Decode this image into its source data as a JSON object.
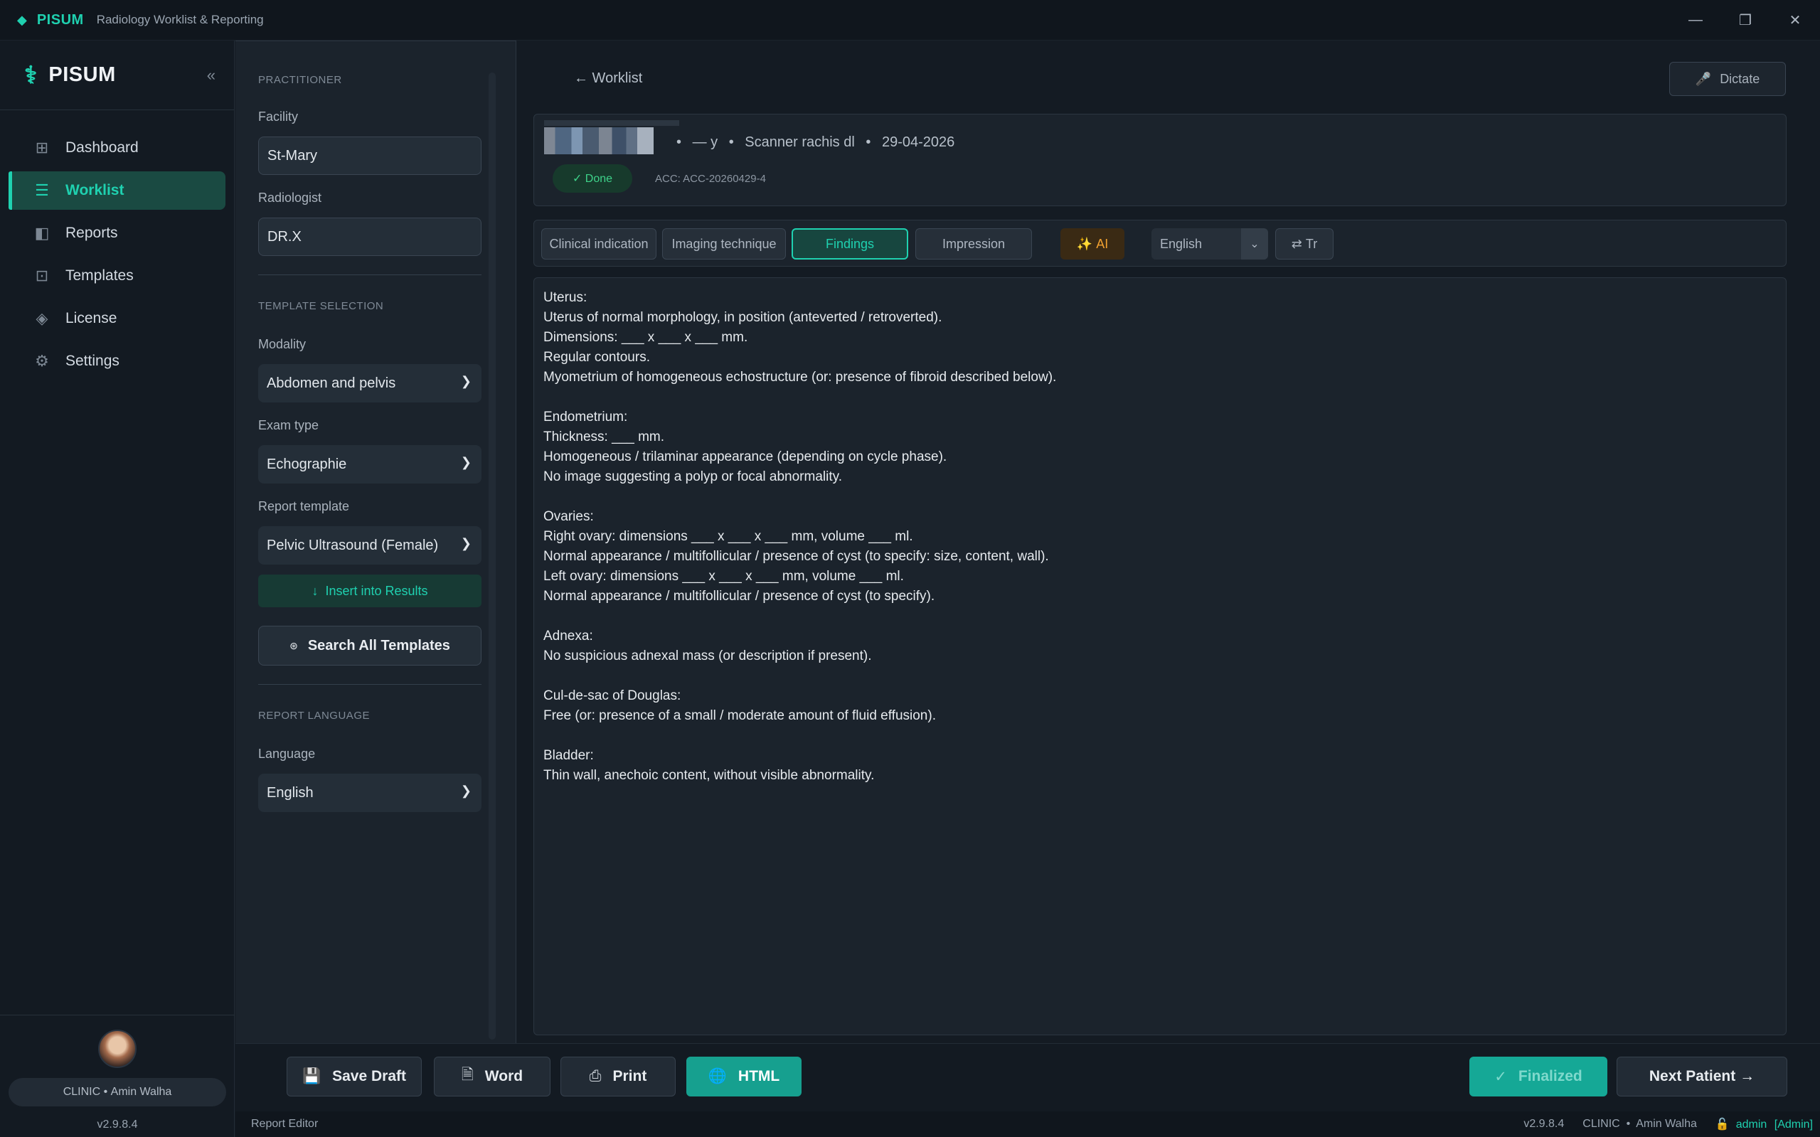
{
  "titlebar": {
    "brand": "PISUM",
    "subtitle": "Radiology Worklist & Reporting"
  },
  "sidebar": {
    "brand": "PISUM",
    "items": [
      {
        "label": "Dashboard",
        "icon": "grid-icon"
      },
      {
        "label": "Worklist",
        "icon": "list-icon",
        "active": true
      },
      {
        "label": "Reports",
        "icon": "report-icon"
      },
      {
        "label": "Templates",
        "icon": "template-icon"
      },
      {
        "label": "License",
        "icon": "license-icon"
      },
      {
        "label": "Settings",
        "icon": "gear-icon"
      }
    ],
    "user": {
      "clinic": "CLINIC",
      "name": "Amin Walha"
    },
    "version": "v2.9.8.4"
  },
  "config": {
    "practitioner_section": "PRACTITIONER",
    "facility_label": "Facility",
    "facility_value": "St-Mary",
    "radiologist_label": "Radiologist",
    "radiologist_value": "DR.X",
    "template_section": "TEMPLATE SELECTION",
    "modality_label": "Modality",
    "modality_value": "Abdomen and pelvis",
    "exam_label": "Exam type",
    "exam_value": "Echographie",
    "template_label": "Report template",
    "template_value": "Pelvic Ultrasound (Female)",
    "insert_label": "Insert into Results",
    "search_label": "Search All Templates",
    "language_section": "REPORT LANGUAGE",
    "language_label": "Language",
    "language_value": "English"
  },
  "main": {
    "back_label": "← Worklist",
    "dictate_label": "Dictate",
    "patient": {
      "age": "— y",
      "exam": "Scanner  rachis dl",
      "date": "29-04-2026",
      "status": "✓ Done",
      "acc": "ACC: ACC-20260429-4"
    },
    "tabs": [
      {
        "label": "Clinical indication"
      },
      {
        "label": "Imaging technique"
      },
      {
        "label": "Findings",
        "active": true
      },
      {
        "label": "Impression"
      }
    ],
    "ai_label": "AI",
    "lang_value": "English",
    "translate_label": "Tr",
    "report_lines": [
      "Uterus:",
      "Uterus of normal morphology, in position (anteverted / retroverted).",
      "Dimensions: ___ x ___ x ___ mm.",
      "Regular contours.",
      "Myometrium of homogeneous echostructure (or: presence of fibroid described below).",
      "",
      "Endometrium:",
      "Thickness: ___ mm.",
      "Homogeneous / trilaminar appearance (depending on cycle phase).",
      "No image suggesting a polyp or focal abnormality.",
      "",
      "Ovaries:",
      "Right ovary: dimensions ___ x ___ x ___ mm, volume ___ ml.",
      "Normal appearance / multifollicular / presence of cyst (to specify: size, content, wall).",
      "Left ovary: dimensions ___ x ___ x ___ mm, volume ___ ml.",
      "Normal appearance / multifollicular / presence of cyst (to specify).",
      "",
      "Adnexa:",
      "No suspicious adnexal mass (or description if present).",
      "",
      "Cul-de-sac of Douglas:",
      "Free (or: presence of a small / moderate amount of fluid effusion).",
      "",
      "Bladder:",
      "Thin wall, anechoic content, without visible abnormality."
    ]
  },
  "actions": {
    "save_draft": "Save Draft",
    "word": "Word",
    "print": "Print",
    "html": "HTML",
    "finalized": "Finalized",
    "next_patient": "Next Patient →"
  },
  "statusbar": {
    "left": "Report Editor",
    "version": "v2.9.8.4",
    "clinic": "CLINIC",
    "name": "Amin Walha",
    "user": "admin",
    "role": "[Admin]"
  }
}
